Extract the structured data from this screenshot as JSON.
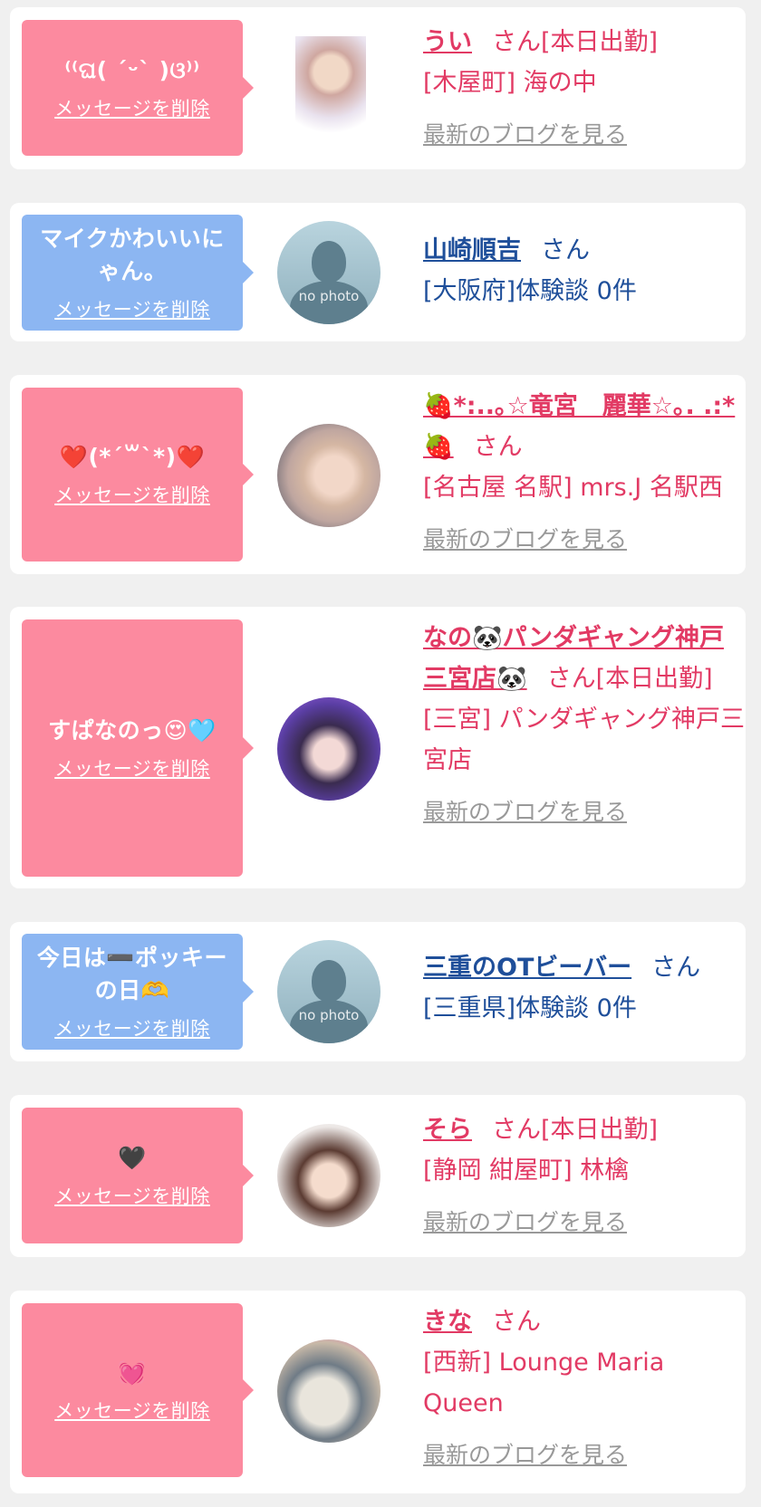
{
  "common": {
    "delete_label": "メッセージを削除",
    "blog_label": "最新のブログを見る",
    "honorific": "さん",
    "no_photo": "no photo"
  },
  "items": [
    {
      "bubble_color": "pink",
      "message": "⁽⁽ଘ( ˊᵕˋ )ଓ⁾⁾",
      "name": "うい",
      "status": "[本日出勤]",
      "location": "[木屋町] 海の中",
      "kind": "cast"
    },
    {
      "bubble_color": "blue",
      "message": "マイクかわいいにゃん。",
      "name": "山崎順吉",
      "location": "[大阪府]体験談 0件",
      "kind": "user"
    },
    {
      "bubble_color": "pink",
      "message": "❤️(*´꒳`*)❤️",
      "name": "🍓*:..｡☆竜宮　麗華☆｡. .:*🍓",
      "location": "[名古屋 名駅] mrs.J 名駅西",
      "kind": "cast"
    },
    {
      "bubble_color": "pink",
      "message": "すぱなのっ😍🩵",
      "name": "なの🐼パンダギャング神戸三宮店🐼",
      "status": "[本日出勤]",
      "location": "[三宮] パンダギャング神戸三宮店",
      "kind": "cast"
    },
    {
      "bubble_color": "blue",
      "message": "今日は➖ポッキーの日🫶",
      "name": "三重のOTビーバー",
      "location": "[三重県]体験談 0件",
      "kind": "user"
    },
    {
      "bubble_color": "pink",
      "message": "🖤",
      "name": "そら",
      "status": "[本日出勤]",
      "location": "[静岡 紺屋町] 林檎",
      "kind": "cast"
    },
    {
      "bubble_color": "pink",
      "message": "💓",
      "name": "きな",
      "location": "[西新] Lounge Maria Queen",
      "kind": "cast"
    }
  ]
}
